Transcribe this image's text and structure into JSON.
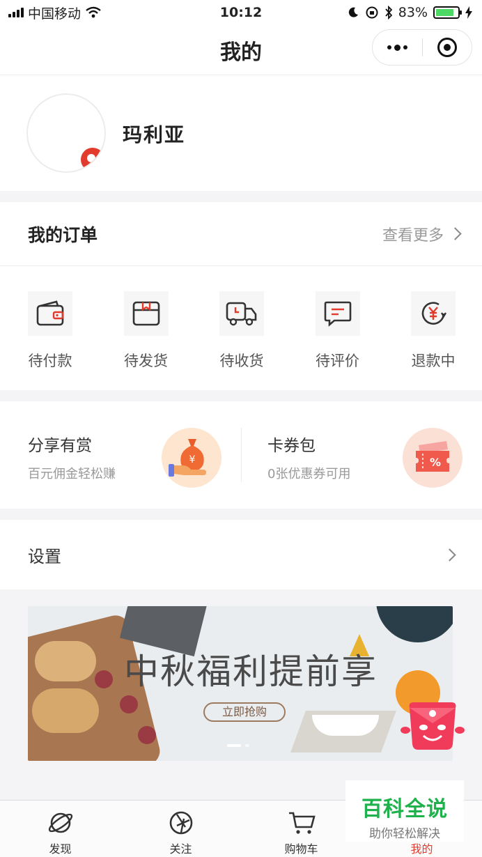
{
  "status_bar": {
    "carrier": "中国移动",
    "time": "10:12",
    "battery": "83%",
    "battery_level": 0.83
  },
  "nav": {
    "title": "我的"
  },
  "profile": {
    "username": "玛利亚"
  },
  "orders": {
    "title": "我的订单",
    "view_more": "查看更多",
    "items": [
      {
        "label": "待付款",
        "icon": "wallet-icon"
      },
      {
        "label": "待发货",
        "icon": "package-icon"
      },
      {
        "label": "待收货",
        "icon": "truck-icon"
      },
      {
        "label": "待评价",
        "icon": "comment-icon"
      },
      {
        "label": "退款中",
        "icon": "refund-icon"
      }
    ]
  },
  "promo": {
    "share": {
      "title": "分享有赏",
      "subtitle": "百元佣金轻松赚",
      "icon": "money-bag-icon"
    },
    "coupons": {
      "title": "卡券包",
      "subtitle": "0张优惠券可用",
      "icon": "coupon-icon"
    }
  },
  "settings": {
    "label": "设置"
  },
  "banner": {
    "headline": "中秋福利提前享",
    "button": "立即抢购",
    "slide_count": 2,
    "active_slide": 1
  },
  "tabbar": {
    "items": [
      {
        "label": "发现",
        "icon": "planet-icon",
        "active": false
      },
      {
        "label": "关注",
        "icon": "aperture-icon",
        "active": false
      },
      {
        "label": "购物车",
        "icon": "cart-icon",
        "active": false
      },
      {
        "label": "我的",
        "icon": "person-icon",
        "active": true
      }
    ]
  },
  "watermark": {
    "title": "百科全说",
    "subtitle": "助你轻松解决"
  },
  "colors": {
    "accent": "#e23b2e",
    "watermark": "#1fb24c",
    "battery": "#4cd964"
  }
}
